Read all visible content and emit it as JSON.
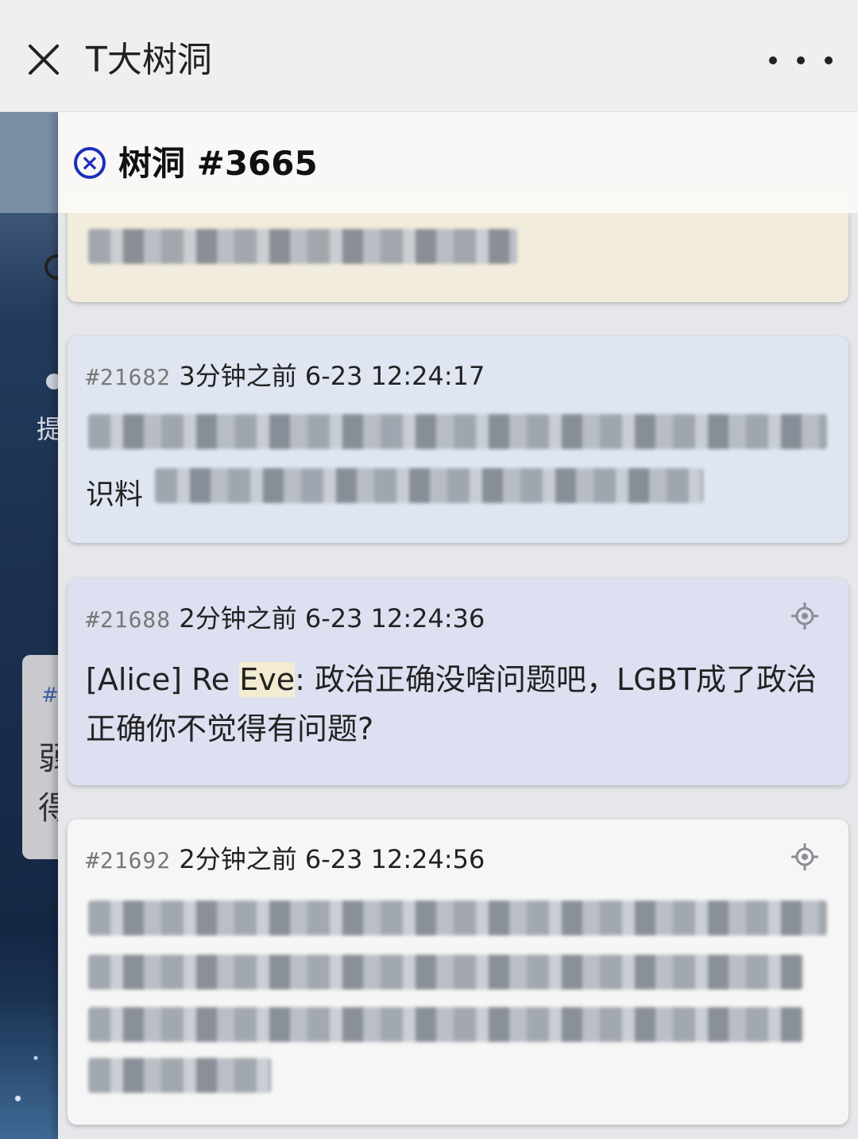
{
  "app": {
    "title": "T大树洞"
  },
  "background": {
    "text_1": "提",
    "card_hash": "#",
    "card_text_1": "弱",
    "card_text_2": "得"
  },
  "panel": {
    "title": "树洞 #3665"
  },
  "posts": [
    {
      "id": "#21682",
      "meta": "3分钟之前 6-23 12:24:17",
      "body_fragment": "识料"
    },
    {
      "id": "#21688",
      "meta": "2分钟之前 6-23 12:24:36",
      "body_before": "[Alice] Re ",
      "body_highlight": "Eve",
      "body_after": ": 政治正确没啥问题吧，LGBT成了政治正确你不觉得有问题?"
    },
    {
      "id": "#21692",
      "meta": "2分钟之前 6-23 12:24:56"
    }
  ],
  "icons": {
    "close": "close-icon",
    "more": "more-icon",
    "panel_close": "circle-x-icon",
    "locate": "crosshair-icon"
  },
  "colors": {
    "accent_blue": "#1d2fb8",
    "card_cream": "#f2ecdc",
    "card_blue": "#dfe6f2",
    "card_lavender": "#dde0f1",
    "card_white": "#f6f6f6",
    "highlight": "#f3ecd2"
  }
}
